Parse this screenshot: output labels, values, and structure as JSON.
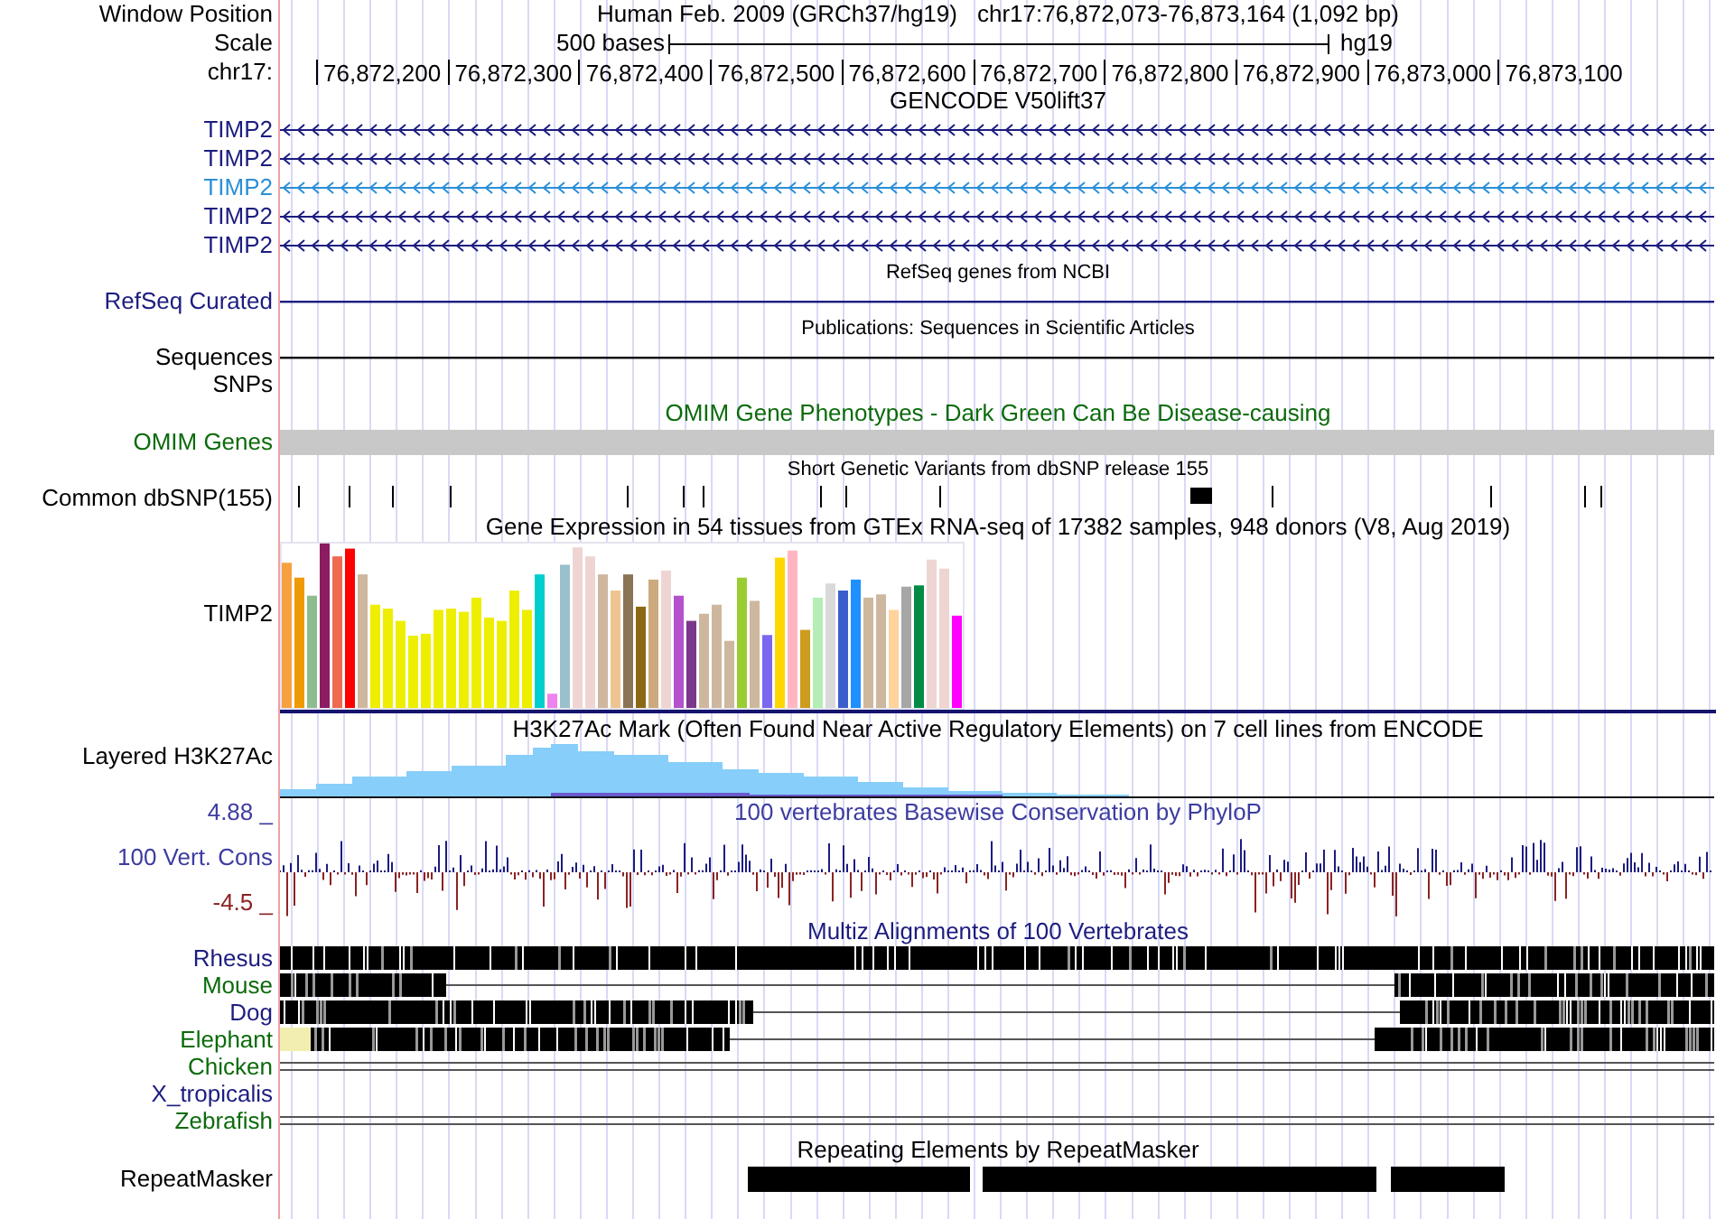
{
  "header": {
    "position_label": "Window Position",
    "assembly": "Human Feb. 2009 (GRCh37/hg19)",
    "position": "chr17:76,872,073-76,873,164 (1,092 bp)",
    "scale_label": "Scale",
    "scale_text": "500 bases",
    "scale_db": "hg19",
    "ruler_label": "chr17:",
    "ruler_ticks": [
      "76,872,200",
      "76,872,300",
      "76,872,400",
      "76,872,500",
      "76,872,600",
      "76,872,700",
      "76,872,800",
      "76,872,900",
      "76,873,000",
      "76,873,100"
    ]
  },
  "tracks": [
    {
      "kind": "genes",
      "title": "GENCODE V50lift37",
      "rows": [
        {
          "label": "TIMP2",
          "color": "#1c1c80"
        },
        {
          "label": "TIMP2",
          "color": "#1c1c80"
        },
        {
          "label": "TIMP2",
          "color": "#2b8fd6"
        },
        {
          "label": "TIMP2",
          "color": "#1c1c80"
        },
        {
          "label": "TIMP2",
          "color": "#1c1c80"
        }
      ]
    },
    {
      "kind": "line",
      "title": "RefSeq genes from NCBI",
      "label": "RefSeq Curated",
      "color": "#1c1c80"
    },
    {
      "kind": "line",
      "title": "Publications: Sequences in Scientific Articles",
      "label": "Sequences",
      "color": "#000000"
    },
    {
      "kind": "empty",
      "label": "SNPs",
      "color": "#000000"
    },
    {
      "kind": "bar",
      "title": "OMIM Gene Phenotypes - Dark Green Can Be Disease-causing",
      "label": "OMIM Genes",
      "color": "#0b6b0b"
    },
    {
      "kind": "snps",
      "title": "Short Genetic Variants from dbSNP release 155",
      "label": "Common dbSNP(155)",
      "color": "#000000"
    },
    {
      "kind": "gtex",
      "title": "Gene Expression in 54 tissues from GTEx RNA-seq of 17382 samples, 948 donors (V8, Aug 2019)",
      "label": "TIMP2",
      "color": "#000000"
    },
    {
      "kind": "layered",
      "title": "H3K27Ac Mark (Often Found Near Active Regulatory Elements) on 7 cell lines from ENCODE",
      "label": "Layered H3K27Ac",
      "color": "#000000"
    },
    {
      "kind": "phylop",
      "title": "100 vertebrates Basewise Conservation by PhyloP",
      "label": "100 Vert. Cons",
      "color": "#3c3ca0",
      "max": "4.88 _",
      "min": "-4.5 _"
    },
    {
      "kind": "multiz",
      "title": "Multiz Alignments of 100 Vertebrates",
      "rows": [
        {
          "label": "Rhesus",
          "color": "#1c1c80"
        },
        {
          "label": "Mouse",
          "color": "#0b6b0b"
        },
        {
          "label": "Dog",
          "color": "#1c1c80"
        },
        {
          "label": "Elephant",
          "color": "#0b6b0b"
        },
        {
          "label": "Chicken",
          "color": "#0b6b0b"
        },
        {
          "label": "X_tropicalis",
          "color": "#1c1c80"
        },
        {
          "label": "Zebrafish",
          "color": "#0b6b0b"
        }
      ]
    },
    {
      "kind": "repeat",
      "title": "Repeating Elements by RepeatMasker",
      "label": "RepeatMasker",
      "color": "#000000"
    }
  ]
}
